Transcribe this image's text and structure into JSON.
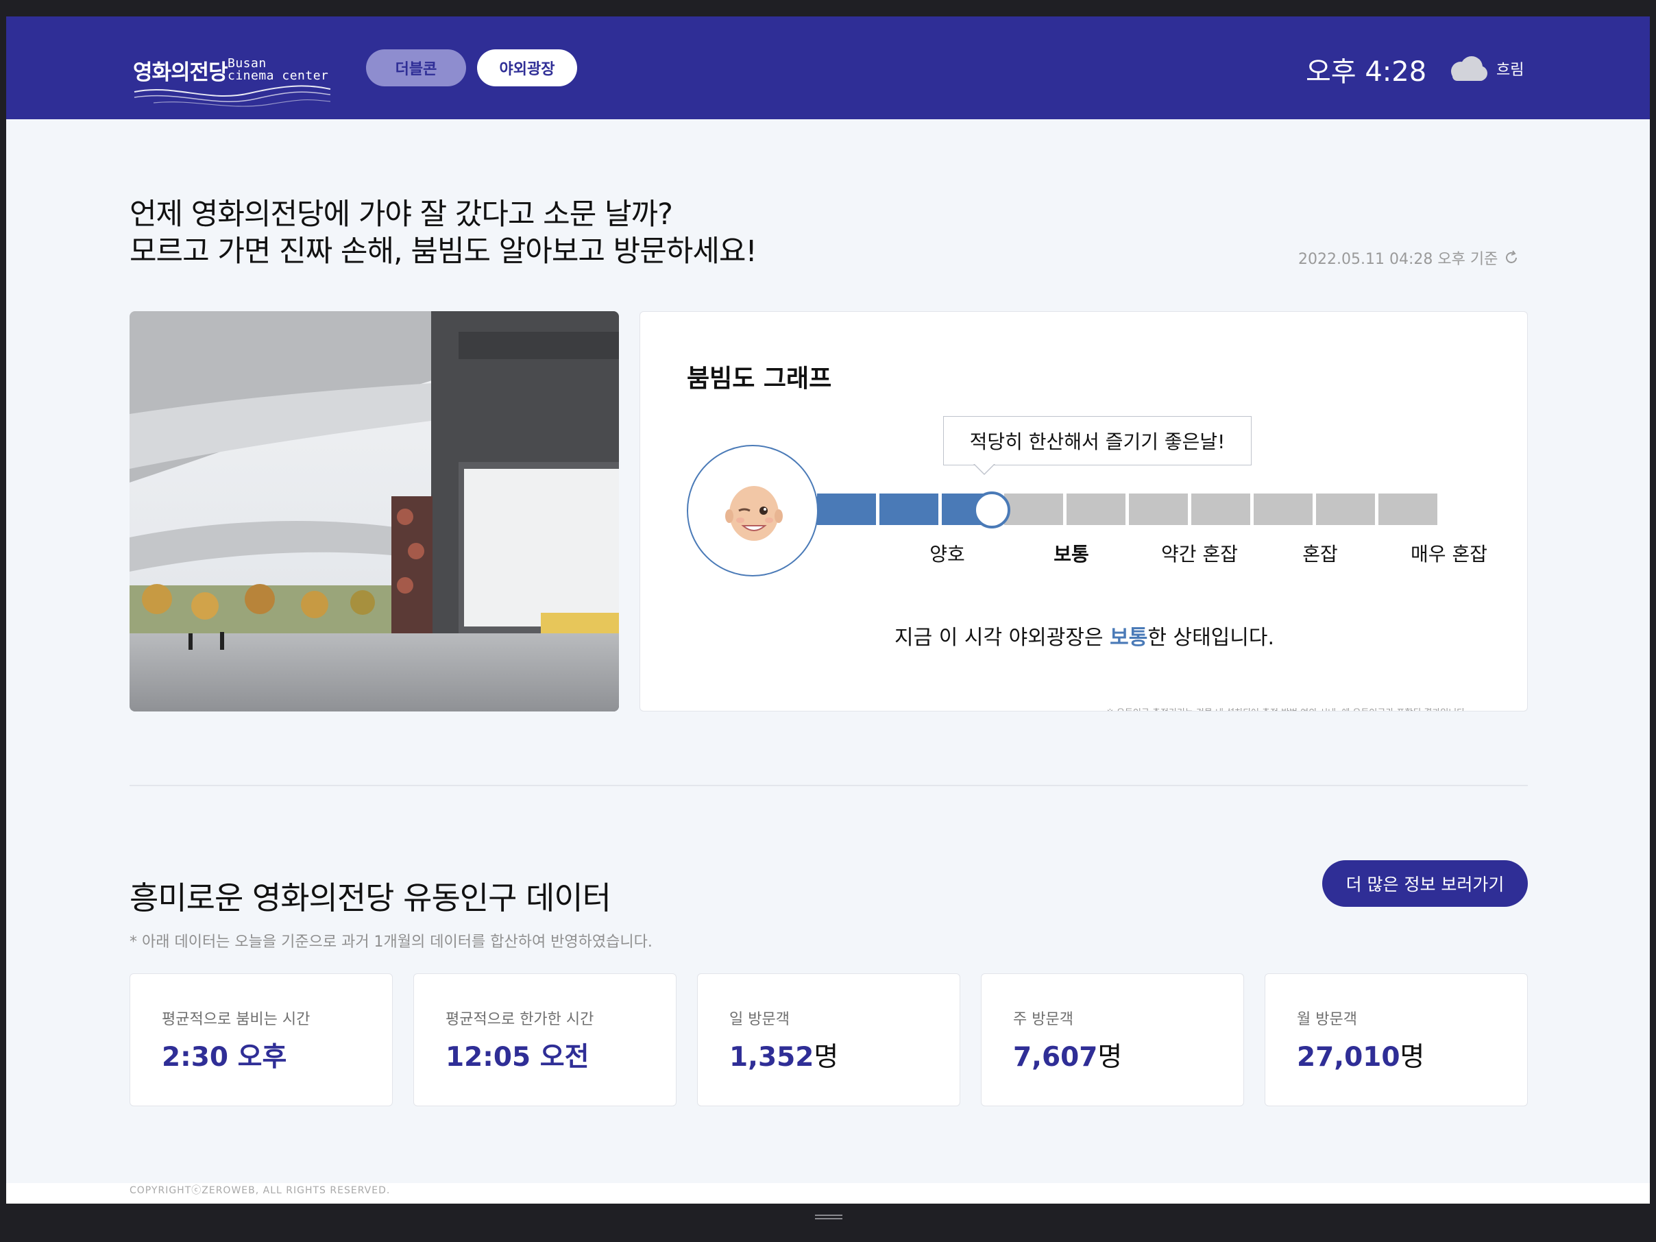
{
  "header": {
    "logo": {
      "korean": "영화의전당",
      "english_line1": "Busan",
      "english_line2": "cinema center"
    },
    "tabs": [
      {
        "label": "더블콘"
      },
      {
        "label": "야외광장"
      }
    ],
    "clock": "오후 4:28",
    "weather": {
      "icon": "cloud-icon",
      "label": "흐림"
    }
  },
  "intro": {
    "headline_line1": "언제 영화의전당에 가야 잘 갔다고 소문 날까?",
    "headline_line2": "모르고 가면 진짜 손해, 붐빔도 알아보고 방문하세요!",
    "timestamp": "2022.05.11 04:28 오후 기준",
    "refresh_icon": "refresh-icon"
  },
  "congestion": {
    "title": "붐빔도 그래프",
    "tooltip": "적당히 한산해서 즐기기 좋은날!",
    "avatar_icon": "winking-face-icon",
    "total_segments": 10,
    "filled_segments": 3,
    "labels": [
      "양호",
      "보통",
      "약간 혼잡",
      "혼잡",
      "매우 혼잡"
    ],
    "active_label": "보통",
    "status_prefix": "지금 이 시각 야외광장은 ",
    "status_highlight": "보통",
    "status_suffix": "한 상태입니다.",
    "fine_print": "※ 유동인구 측정기기는 건물 내 설치되어 측정 방법 여의 시내, 에 유동인구가 포함된 결과입니다.",
    "colors": {
      "filled": "#4a7ab7",
      "empty": "#c4c4c4",
      "accent": "#4a7ab7"
    }
  },
  "stats_section": {
    "title": "흥미로운 영화의전당 유동인구 데이터",
    "note": "* 아래 데이터는 오늘을 기준으로 과거 1개월의 데이터를 합산하여 반영하였습니다.",
    "more_button": "더 많은 정보 보러가기",
    "cards": [
      {
        "label": "평균적으로 붐비는 시간",
        "value": "2:30 오후",
        "unit": ""
      },
      {
        "label": "평균적으로 한가한 시간",
        "value": "12:05 오전",
        "unit": ""
      },
      {
        "label": "일 방문객",
        "value": "1,352",
        "unit": "명"
      },
      {
        "label": "주 방문객",
        "value": "7,607",
        "unit": "명"
      },
      {
        "label": "월 방문객",
        "value": "27,010",
        "unit": "명"
      }
    ]
  },
  "footer": {
    "copyright": "COPYRIGHTⓒZEROWEB, ALL RIGHTS RESERVED."
  },
  "theme": {
    "brand": "#2f2e96",
    "background": "#f3f6fa"
  }
}
